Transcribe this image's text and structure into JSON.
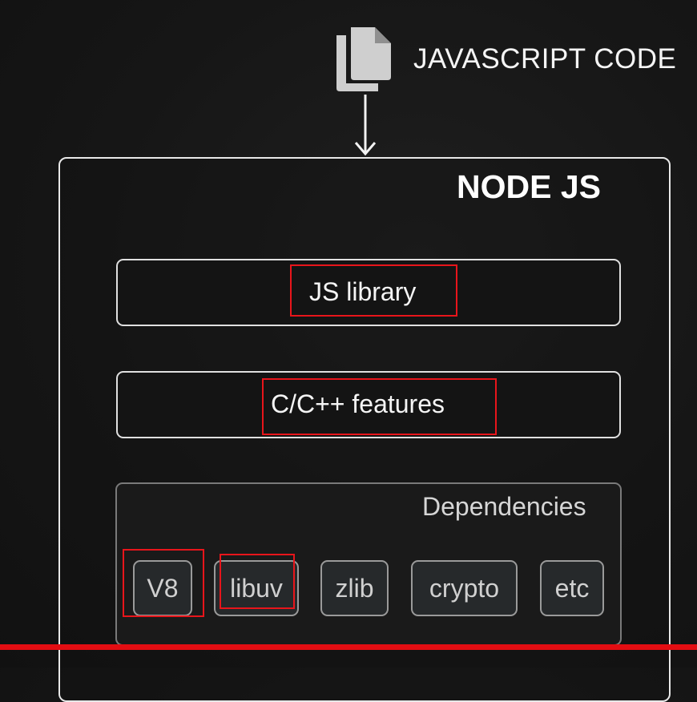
{
  "header": {
    "icon": "copy-documents-icon",
    "label": "JAVASCRIPT CODE"
  },
  "node": {
    "title": "NODE JS",
    "layers": {
      "js_library": "JS library",
      "cpp_features": "C/C++ features"
    },
    "dependencies": {
      "title": "Dependencies",
      "items": [
        "V8",
        "libuv",
        "zlib",
        "crypto",
        "etc"
      ]
    }
  },
  "colors": {
    "background": "#161616",
    "box_border": "#e8e8e8",
    "chip_background": "#26292b",
    "highlight": "#e8151b"
  }
}
